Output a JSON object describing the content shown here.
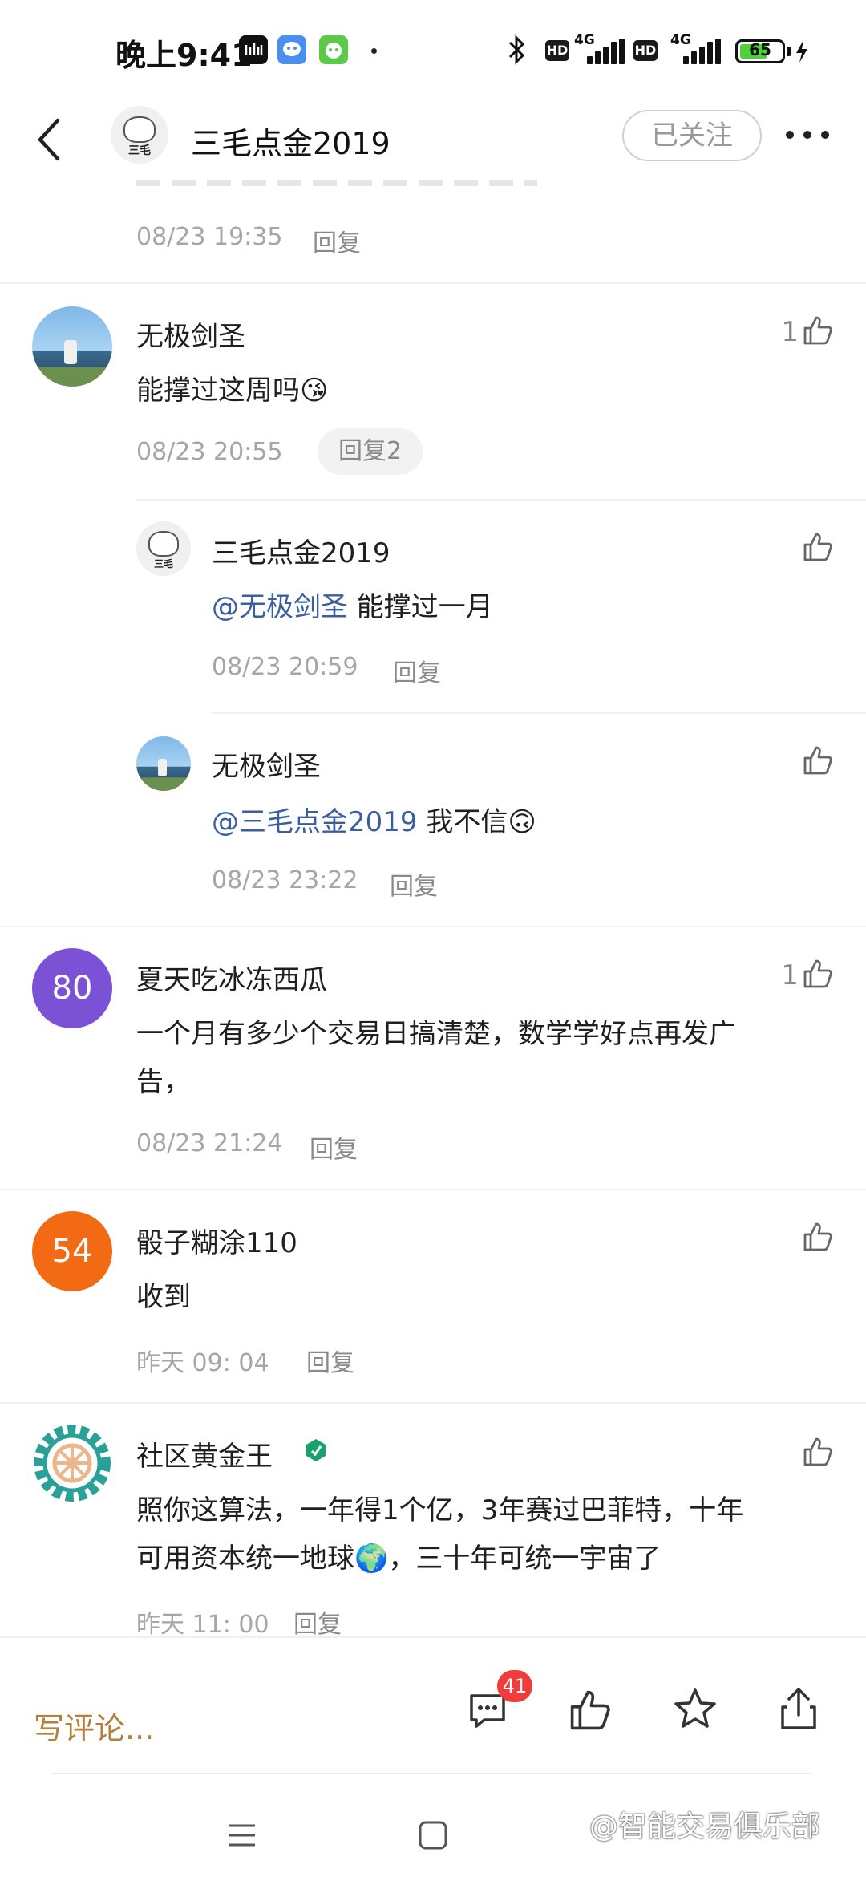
{
  "status_bar": {
    "time": "晚上9:41",
    "network_1": "4G",
    "network_2": "4G",
    "hd_1": "HD",
    "hd_2": "HD",
    "battery": "65"
  },
  "header": {
    "title": "三毛点金2019",
    "follow_label": "已关注",
    "avatar_char": "三毛"
  },
  "top_partial": {
    "time": "08/23 19:35",
    "reply": "回复"
  },
  "comments": [
    {
      "user": "无极剑圣",
      "text": "能撑过这周吗😘",
      "time": "08/23 20:55",
      "reply": "回复2",
      "likes": "1",
      "replies": [
        {
          "user": "三毛点金2019",
          "mention": "@无极剑圣",
          "text": " 能撑过一月",
          "time": "08/23 20:59",
          "reply": "回复"
        },
        {
          "user": "无极剑圣",
          "mention": "@三毛点金2019",
          "text": " 我不信🙃",
          "time": "08/23 23:22",
          "reply": "回复"
        }
      ]
    },
    {
      "user": "夏天吃冰冻西瓜",
      "avatar_num": "80",
      "avatar_color": "#7b52d6",
      "text_line1": "一个月有多少个交易日搞清楚，数学学好点再发广",
      "text_line2": "告，",
      "time": "08/23 21:24",
      "reply": "回复",
      "likes": "1"
    },
    {
      "user": "骰子糊涂110",
      "avatar_num": "54",
      "avatar_color": "#f36a14",
      "text": "收到",
      "time": "昨天 09: 04",
      "reply": "回复"
    },
    {
      "user": "社区黄金王",
      "text_line1": "照你这算法，一年得1个亿，3年赛过巴菲特，十年",
      "text_line2": "可用资本统一地球🌍，三十年可统一宇宙了",
      "time": "昨天 11: 00",
      "reply": "回复"
    }
  ],
  "bottom_bar": {
    "write_comment": "写评论...",
    "comment_count": "41"
  },
  "watermark": "@智能交易俱乐部",
  "colors": {
    "accent_comment": "#b5803f",
    "mention": "#3a5f9e",
    "badge": "#f03c3c"
  }
}
